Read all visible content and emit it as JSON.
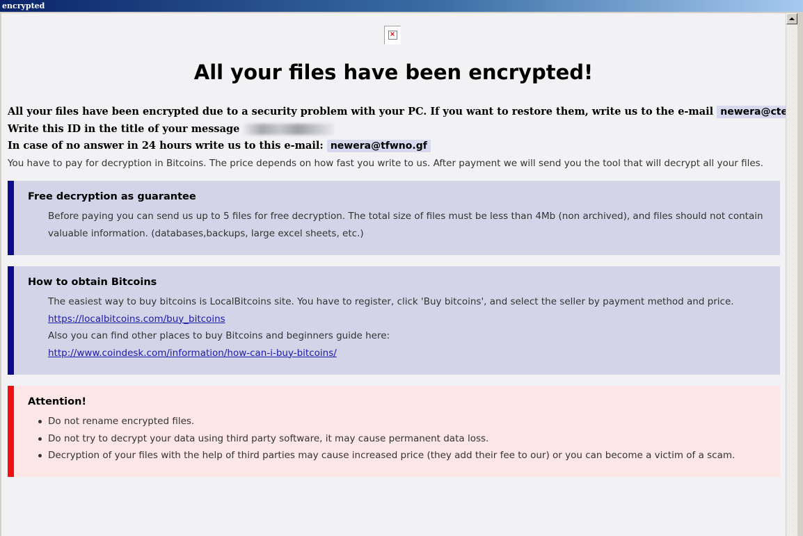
{
  "window": {
    "title": "encrypted"
  },
  "heading": "All your files have been encrypted!",
  "intro": {
    "line1_text": "All your files have been encrypted due to a security problem with your PC. If you want to restore them, write us to the e-mail",
    "line1_email": "newera@ctemplar.com",
    "line2_text": "Write this ID in the title of your message",
    "line3_text": "In case of no answer in 24 hours write us to this e-mail:",
    "line3_email": "newera@tfwno.gf",
    "line4_text": "You have to pay for decryption in Bitcoins. The price depends on how fast you write to us. After payment we will send you the tool that will decrypt all your files."
  },
  "free_box": {
    "title": "Free decryption as guarantee",
    "text": "Before paying you can send us up to 5 files for free decryption. The total size of files must be less than 4Mb (non archived), and files should not contain valuable information. (databases,backups, large excel sheets, etc.)"
  },
  "bitcoin_box": {
    "title": "How to obtain Bitcoins",
    "text1": "The easiest way to buy bitcoins is LocalBitcoins site. You have to register, click 'Buy bitcoins', and select the seller by payment method and price.",
    "link1": "https://localbitcoins.com/buy_bitcoins",
    "text2": "Also you can find other places to buy Bitcoins and beginners guide here:",
    "link2": "http://www.coindesk.com/information/how-can-i-buy-bitcoins/"
  },
  "attention_box": {
    "title": "Attention!",
    "items": [
      "Do not rename encrypted files.",
      "Do not try to decrypt your data using third party software, it may cause permanent data loss.",
      "Decryption of your files with the help of third parties may cause increased price (they add their fee to our) or you can become a victim of a scam."
    ]
  },
  "colors": {
    "accent_blue": "#0c0c8a",
    "accent_red": "#ee1111",
    "box_blue_bg": "#d4d4e8",
    "box_red_bg": "#fce6e6"
  },
  "icons": {
    "broken_image": "broken-image-icon",
    "scroll_up": "scroll-up-arrow-icon"
  }
}
